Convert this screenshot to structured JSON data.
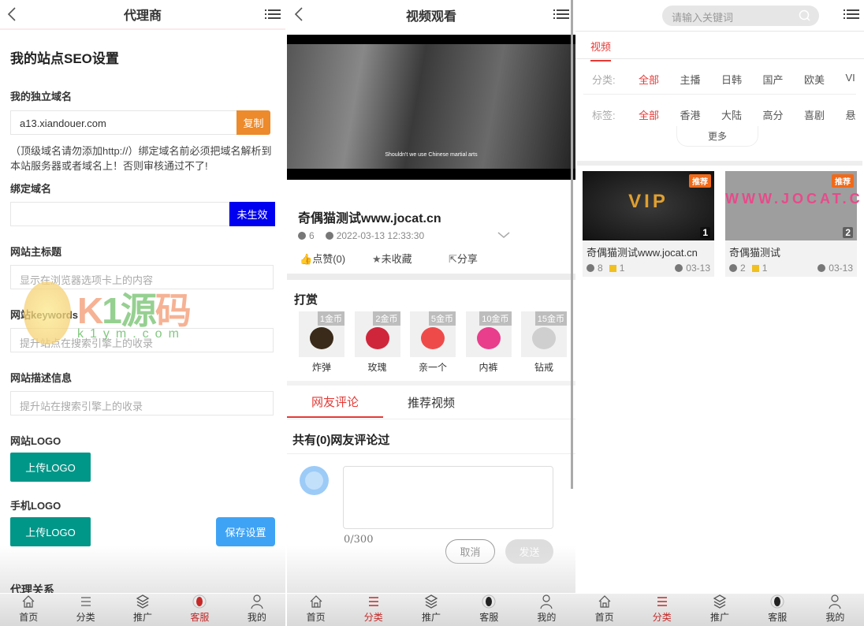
{
  "agent_panel": {
    "title": "代理商",
    "section_title": "我的站点SEO设置",
    "domain_label": "我的独立域名",
    "domain_value": "a13.xiandouer.com",
    "copy_button": "复制",
    "domain_note": "（顶级域名请勿添加http://）绑定域名前必须把域名解析到本站服务器或者域名上！否则审核通过不了!",
    "bind_label": "绑定域名",
    "bind_value": "",
    "bind_status_button": "未生效",
    "title_label": "网站主标题",
    "title_placeholder": "显示在浏览器选项卡上的内容",
    "keywords_label": "网站keywords",
    "keywords_placeholder": "提升站点在搜索引擎上的收录",
    "desc_label": "网站描述信息",
    "desc_placeholder": "提升站在搜索引擎上的收录",
    "logo_label": "网站LOGO",
    "logo_upload": "上传LOGO",
    "mobile_logo_label": "手机LOGO",
    "mobile_logo_upload": "上传LOGO",
    "save_button": "保存设置",
    "next_section": "代理关系",
    "watermark": {
      "brand": "K1源码",
      "url": "k1ym.com"
    }
  },
  "video_panel": {
    "title": "视频观看",
    "subtitle": "Shouldn't we use Chinese martial arts",
    "video_title": "奇偶猫测试www.jocat.cn",
    "views": "6",
    "datetime": "2022-03-13 12:33:30",
    "like": "点赞(0)",
    "favorite": "未收藏",
    "share": "分享",
    "reward_title": "打赏",
    "gifts": [
      {
        "price": "1金币",
        "name": "炸弹"
      },
      {
        "price": "2金币",
        "name": "玫瑰"
      },
      {
        "price": "5金币",
        "name": "亲一个"
      },
      {
        "price": "10金币",
        "name": "内裤"
      },
      {
        "price": "15金币",
        "name": "钻戒"
      }
    ],
    "tabs": [
      "网友评论",
      "推荐视频"
    ],
    "comment_count": "共有(0)网友评论过",
    "comment_counter": "0/300",
    "cancel": "取消",
    "send": "发送"
  },
  "list_panel": {
    "search_placeholder": "请输入关键词",
    "tab": "视频",
    "category_label": "分类:",
    "categories": [
      "全部",
      "主播",
      "日韩",
      "国产",
      "欧美",
      "VI"
    ],
    "tag_label": "标签:",
    "tags": [
      "全部",
      "香港",
      "大陆",
      "高分",
      "喜剧",
      "悬"
    ],
    "more": "更多",
    "videos": [
      {
        "title": "奇偶猫测试www.jocat.cn",
        "badge": "推荐",
        "rank": "1",
        "views": "8",
        "coins": "1",
        "date": "03-13",
        "thumb_text": "VIP"
      },
      {
        "title": "奇偶猫测试",
        "badge": "推荐",
        "rank": "2",
        "views": "2",
        "coins": "1",
        "date": "03-13",
        "thumb_text": "WWW.JOCAT.C"
      }
    ]
  },
  "nav": {
    "items": [
      "首页",
      "分类",
      "推广",
      "客服",
      "我的"
    ],
    "active_color": "#c62828"
  }
}
